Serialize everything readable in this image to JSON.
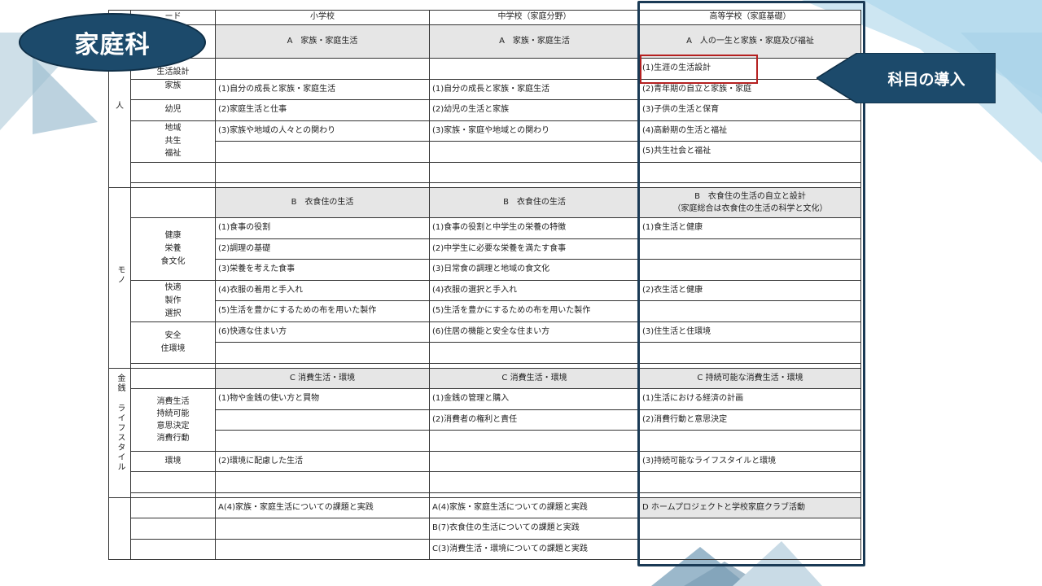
{
  "title": "家庭科",
  "callout": "科目の導入",
  "colors": {
    "navy": "#1c4a6b",
    "accent_red": "#b52020",
    "header_gray": "#e6e6e6",
    "light_blue": "#a9d4e8"
  },
  "table": {
    "col_header_partial": "ード",
    "col_elementary": "小学校",
    "col_junior": "中学校（家庭分野）",
    "col_high": "高等学校（家庭基礎）",
    "secA": {
      "cat": "人",
      "elem_header": "A　家族・家庭生活",
      "jr_header": "A　家族・家庭生活",
      "hs_header": "A　人の一生と家族・家庭及び福祉",
      "kw1": "生活設計",
      "kw2": "家族",
      "kw3": "幼児",
      "kw4": "地域\n共生\n福祉",
      "e1": "(1)自分の成長と家族・家庭生活",
      "e2": "(2)家庭生活と仕事",
      "e3": "(3)家族や地域の人々との関わり",
      "j1": "(1)自分の成長と家族・家庭生活",
      "j2": "(2)幼児の生活と家族",
      "j3": "(3)家族・家庭や地域との関わり",
      "h1": "(1)生涯の生活設計",
      "h2": "(2)青年期の自立と家族・家庭",
      "h3": "(3)子供の生活と保育",
      "h4": "(4)高齢期の生活と福祉",
      "h5": "(5)共生社会と福祉"
    },
    "secB": {
      "cat": "モノ",
      "elem_header": "B　衣食住の生活",
      "jr_header": "B　衣食住の生活",
      "hs_header": "B　衣食住の生活の自立と設計\n（家庭総合は衣食住の生活の科学と文化）",
      "kw1": "健康\n栄養\n食文化",
      "kw2": "快適\n製作\n選択",
      "kw3": "安全\n住環境",
      "e1": "(1)食事の役割",
      "e2": "(2)調理の基礎",
      "e3": "(3)栄養を考えた食事",
      "e4": "(4)衣服の着用と手入れ",
      "e5": "(5)生活を豊かにするための布を用いた製作",
      "e6": "(6)快適な住まい方",
      "j1": "(1)食事の役割と中学生の栄養の特徴",
      "j2": "(2)中学生に必要な栄養を満たす食事",
      "j3": "(3)日常食の調理と地域の食文化",
      "j4": "(4)衣服の選択と手入れ",
      "j5": "(5)生活を豊かにするための布を用いた製作",
      "j6": "(6)住居の機能と安全な住まい方",
      "h1": "(1)食生活と健康",
      "h2": "(2)衣生活と健康",
      "h3": "(3)住生活と住環境"
    },
    "secC": {
      "cat1": "金銭",
      "cat2": "ライフスタイル",
      "elem_header": "C 消費生活・環境",
      "jr_header": "C 消費生活・環境",
      "hs_header": "C 持続可能な消費生活・環境",
      "kw1": "消費生活\n持続可能\n意思決定\n消費行動",
      "kw2": "環境",
      "e1": "(1)物や金銭の使い方と買物",
      "e2": "(2)環境に配慮した生活",
      "j1": "(1)金銭の管理と購入",
      "j2": "(2)消費者の権利と責任",
      "h1": "(1)生活における経済の計画",
      "h2": "(2)消費行動と意思決定",
      "h3": "(3)持続可能なライフスタイルと環境"
    },
    "secD": {
      "e1": "A(4)家族・家庭生活についての課題と実践",
      "j1": "A(4)家族・家庭生活についての課題と実践",
      "j2": "B(7)衣食住の生活についての課題と実践",
      "j3": "C(3)消費生活・環境についての課題と実践",
      "h1": "D ホームプロジェクトと学校家庭クラブ活動"
    }
  }
}
